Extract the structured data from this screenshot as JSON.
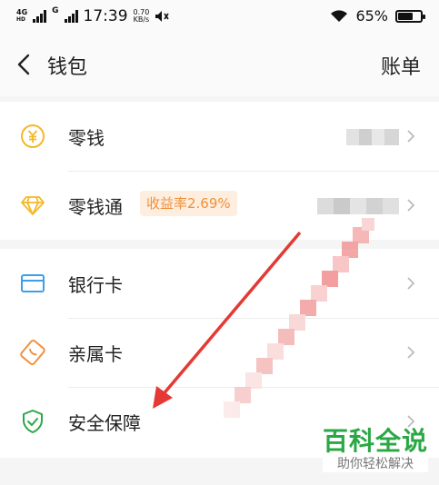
{
  "status_bar": {
    "network_label": "4G",
    "network_sub": "HD",
    "g_label": "G",
    "time": "17:39",
    "speed_value": "0.70",
    "speed_unit": "KB/s",
    "battery": "65%",
    "battery_level": 0.65
  },
  "header": {
    "title": "钱包",
    "right_action": "账单"
  },
  "wallet_items": [
    {
      "label": "零钱",
      "icon": "yuan-coin-icon"
    },
    {
      "label": "零钱通",
      "icon": "diamond-icon",
      "badge": "收益率2.69%"
    }
  ],
  "card_items": [
    {
      "label": "银行卡",
      "icon": "bank-card-icon"
    },
    {
      "label": "亲属卡",
      "icon": "family-card-icon"
    },
    {
      "label": "安全保障",
      "icon": "shield-check-icon"
    }
  ],
  "watermark": {
    "title": "百科全说",
    "subtitle": "助你轻松解决"
  },
  "colors": {
    "accent_yellow": "#f5b826",
    "accent_blue": "#3ba0e6",
    "accent_orange": "#f0903c",
    "accent_green": "#2aa845",
    "arrow_red": "#e53935"
  }
}
